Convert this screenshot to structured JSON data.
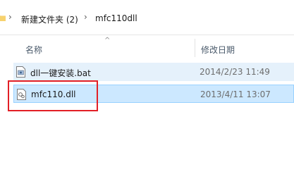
{
  "breadcrumb": {
    "items": [
      "新建文件夹 (2)",
      "mfc110dll"
    ],
    "separator": "›"
  },
  "columns": {
    "name": "名称",
    "modified": "修改日期"
  },
  "files": [
    {
      "name": "dll一键安装.bat",
      "modified": "2014/2/23 11:49",
      "icon": "batch-file-icon",
      "state": "hover"
    },
    {
      "name": "mfc110.dll",
      "modified": "2013/4/11 13:07",
      "icon": "dll-file-icon",
      "state": "selected"
    }
  ],
  "colors": {
    "selection_bg": "#cce8ff",
    "hover_bg": "#e5f1fb",
    "annotation_red": "#e21f26"
  }
}
